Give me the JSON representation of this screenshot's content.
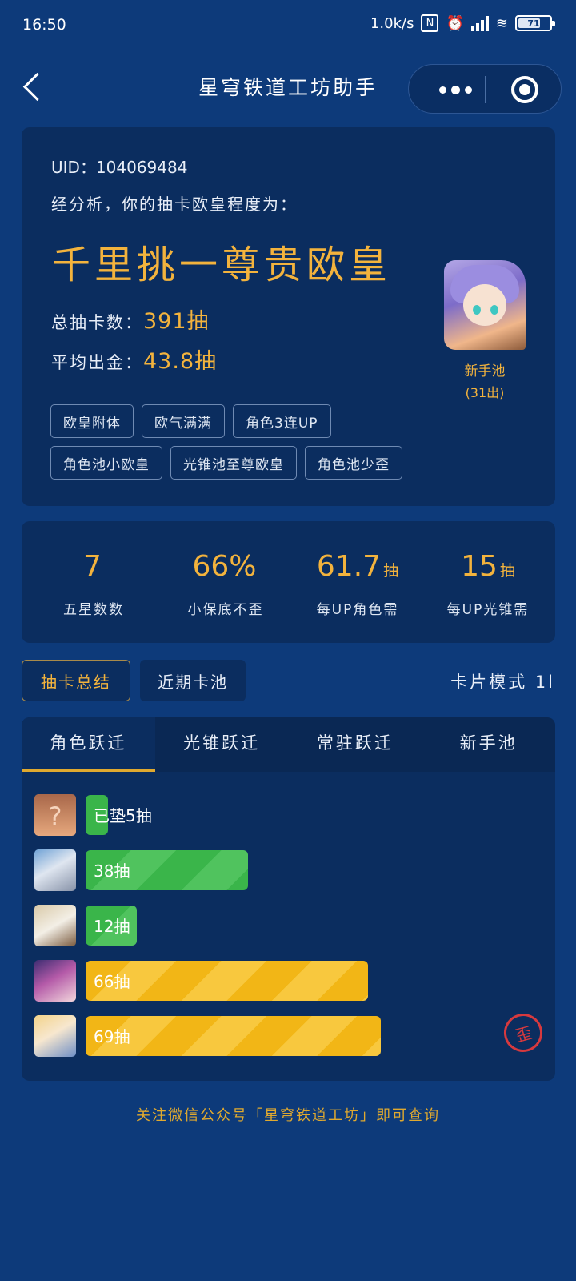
{
  "status_bar": {
    "time": "16:50",
    "net_speed": "1.0k/s",
    "nfc": "N",
    "battery": "71",
    "battery_level": 0.71
  },
  "nav": {
    "title": "星穹铁道工坊助手"
  },
  "summary": {
    "uid": "UID：104069484",
    "analysis": "经分析，你的抽卡欧皇程度为：",
    "rank": "千里挑一尊贵欧皇",
    "total_label": "总抽卡数：",
    "total_value": "391抽",
    "avg_label": "平均出金：",
    "avg_value": "43.8抽",
    "pool_name": "新手池",
    "pool_count": "(31出)",
    "tags": [
      "欧皇附体",
      "欧气满满",
      "角色3连UP",
      "角色池小欧皇",
      "光锥池至尊欧皇",
      "角色池少歪"
    ]
  },
  "stats": [
    {
      "num": "7",
      "unit": "",
      "label": "五星数数"
    },
    {
      "num": "66%",
      "unit": "",
      "label": "小保底不歪"
    },
    {
      "num": "61.7",
      "unit": "抽",
      "label": "每UP角色需"
    },
    {
      "num": "15",
      "unit": "抽",
      "label": "每UP光锥需"
    }
  ],
  "view": {
    "summary_btn": "抽卡总结",
    "recent_btn": "近期卡池",
    "mode": "卡片模式 1l"
  },
  "pool_tabs": [
    "角色跃迁",
    "光锥跃迁",
    "常驻跃迁",
    "新手池"
  ],
  "pulls": [
    {
      "label": "已垫5抽",
      "value": 5,
      "color": "green"
    },
    {
      "label": "38抽",
      "value": 38,
      "color": "green"
    },
    {
      "label": "12抽",
      "value": 12,
      "color": "green"
    },
    {
      "label": "66抽",
      "value": 66,
      "color": "gold"
    },
    {
      "label": "69抽",
      "value": 69,
      "color": "gold"
    }
  ],
  "crooked_badge": "歪",
  "footer": "关注微信公众号「星穹铁道工坊」即可查询",
  "colors": {
    "background": "#0d3a7a",
    "card": "#0b2d5f",
    "accent": "#f3b33d",
    "green": "#3ab54a",
    "gold": "#f2b616",
    "red": "#d6393e"
  }
}
